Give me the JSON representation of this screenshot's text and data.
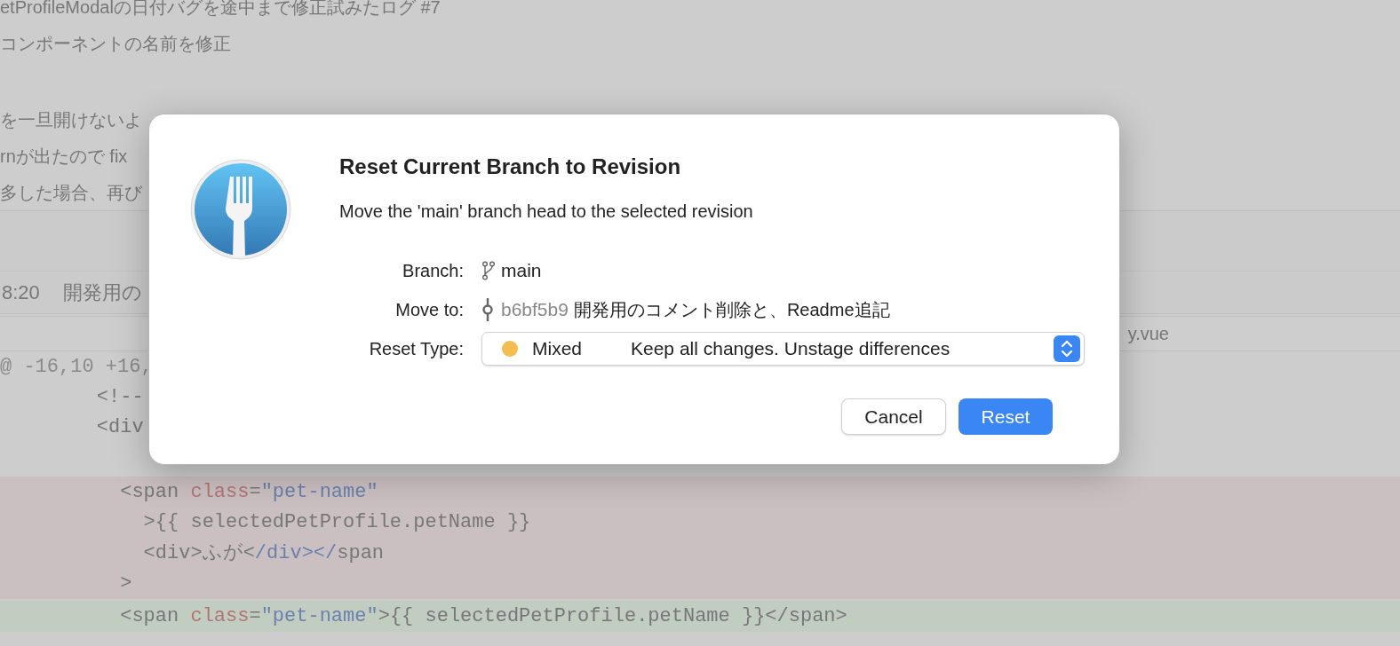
{
  "background": {
    "commit_messages": [
      "etProfileModalの日付バグを途中まで修正試みたログ #7",
      "コンポーネントの名前を修正",
      "を一旦開けないよ",
      "rnが出たので fix",
      "多した場合、再び"
    ],
    "commit_row": {
      "time": "8:20",
      "message": "開発用の"
    },
    "file_header": {
      "name": "y.vue"
    },
    "diff": {
      "hunk_header": "@ -16,10 +16,",
      "lines": [
        {
          "kind": "context",
          "segments": [
            {
              "kind": "plain",
              "text": "    <!--"
            }
          ]
        },
        {
          "kind": "context",
          "segments": [
            {
              "kind": "plain",
              "text": "    <div"
            }
          ]
        },
        {
          "kind": "removed",
          "segments": [
            {
              "kind": "plain",
              "text": "      <span "
            },
            {
              "kind": "attr",
              "text": "class"
            },
            {
              "kind": "plain",
              "text": "="
            },
            {
              "kind": "string",
              "text": "\"pet-name\""
            }
          ]
        },
        {
          "kind": "removed",
          "segments": [
            {
              "kind": "plain",
              "text": "        >{{ selectedPetProfile.petName }}"
            }
          ]
        },
        {
          "kind": "removed",
          "segments": [
            {
              "kind": "plain",
              "text": "        <div>ふが<"
            },
            {
              "kind": "string",
              "text": "/div></"
            },
            {
              "kind": "plain",
              "text": "span"
            }
          ]
        },
        {
          "kind": "removed",
          "segments": [
            {
              "kind": "plain",
              "text": "      >"
            }
          ]
        },
        {
          "kind": "added",
          "segments": [
            {
              "kind": "plain",
              "text": "      <span "
            },
            {
              "kind": "attr",
              "text": "class"
            },
            {
              "kind": "plain",
              "text": "="
            },
            {
              "kind": "string",
              "text": "\"pet-name\""
            },
            {
              "kind": "plain",
              "text": ">{{ selectedPetProfile.petName }}</span>"
            }
          ]
        }
      ]
    }
  },
  "dialog": {
    "title": "Reset Current Branch to Revision",
    "subtitle": "Move the 'main' branch head to the selected revision",
    "branch": {
      "label": "Branch:",
      "value": "main"
    },
    "move_to": {
      "label": "Move to:",
      "hash": "b6bf5b9",
      "message": "開発用のコメント削除と、Readme追記"
    },
    "reset_type": {
      "label": "Reset Type:",
      "color": "#f3bd4f",
      "value": "Mixed",
      "description": "Keep all changes. Unstage differences"
    },
    "buttons": [
      {
        "label": "Cancel",
        "kind": "secondary"
      },
      {
        "label": "Reset",
        "kind": "primary"
      }
    ]
  }
}
